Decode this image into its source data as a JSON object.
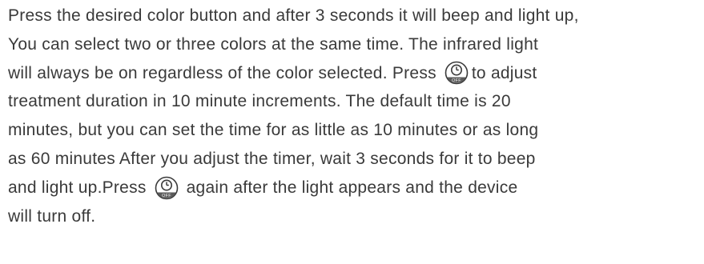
{
  "paragraph": {
    "line1": "Press the desired color button and after 3 seconds it will beep and light up,",
    "line2": "You can select two or three colors at the same time. The infrared light",
    "line3_before": "will always be on regardless of the color selected. Press",
    "line3_after": "to adjust",
    "line4": "treatment duration in 10 minute increments. The default time is 20",
    "line5": "minutes, but you can set the time for as little as 10 minutes or as long",
    "line6": "as 60 minutes After you adjust the timer, wait 3 seconds for it to beep",
    "line7_before": "and light up.Press",
    "line7_after": "again after the light appears and the device",
    "line8": "will turn off."
  },
  "timer_button": {
    "icon": "clock-icon",
    "label": "OFF",
    "fill_color": "#5a5a5a",
    "outline_color": "#3a3a3a"
  }
}
